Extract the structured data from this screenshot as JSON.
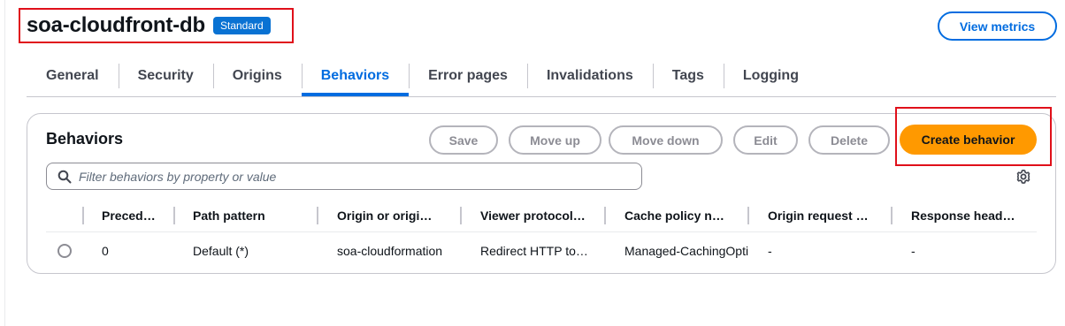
{
  "header": {
    "title": "soa-cloudfront-db",
    "badge": "Standard",
    "view_metrics_label": "View metrics"
  },
  "tabs": [
    {
      "label": "General"
    },
    {
      "label": "Security"
    },
    {
      "label": "Origins"
    },
    {
      "label": "Behaviors",
      "active": true
    },
    {
      "label": "Error pages"
    },
    {
      "label": "Invalidations"
    },
    {
      "label": "Tags"
    },
    {
      "label": "Logging"
    }
  ],
  "behaviors": {
    "title": "Behaviors",
    "buttons": {
      "save": "Save",
      "move_up": "Move up",
      "move_down": "Move down",
      "edit": "Edit",
      "delete": "Delete",
      "create": "Create behavior"
    },
    "search": {
      "placeholder": "Filter behaviors by property or value",
      "value": ""
    },
    "columns": [
      "Precedence",
      "Path pattern",
      "Origin or origin group",
      "Viewer protocol policy",
      "Cache policy name",
      "Origin request policy name",
      "Response headers policy name"
    ],
    "rows": [
      {
        "precedence": "0",
        "path_pattern": "Default (*)",
        "origin": "soa-cloudformation",
        "viewer_protocol": "Redirect HTTP to HTTPS",
        "cache_policy": "Managed-CachingOptimized",
        "origin_request": "-",
        "response_headers": "-"
      }
    ]
  },
  "colors": {
    "accent": "#006ce0",
    "badge_bg": "#0972d3",
    "primary_button": "#ff9900",
    "highlight_box": "#e0101a",
    "disabled_text": "#8c8c94"
  },
  "icons": {
    "search": "search-icon",
    "settings": "gear-icon"
  }
}
